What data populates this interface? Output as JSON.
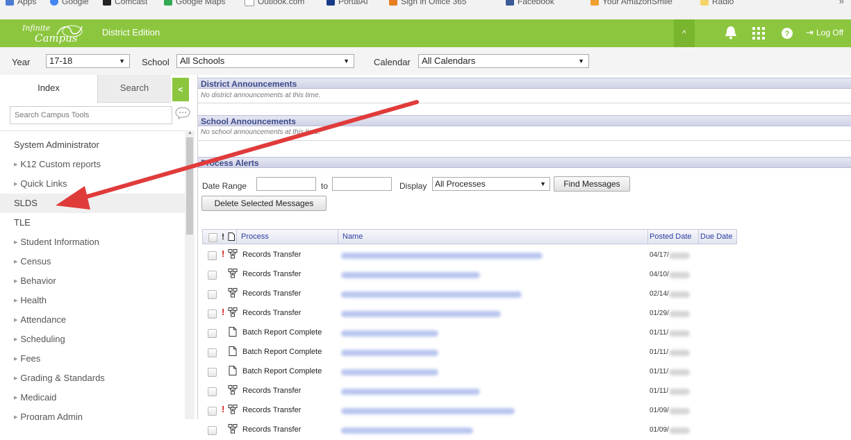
{
  "bookmarks": [
    {
      "label": "Apps",
      "color": "#4a7bd0"
    },
    {
      "label": "Google",
      "color": "#4285f4"
    },
    {
      "label": "Comcast",
      "color": "#222222"
    },
    {
      "label": "Google Maps",
      "color": "#34a853"
    },
    {
      "label": "Outlook.com",
      "color": "#cccccc"
    },
    {
      "label": "PortalAI",
      "color": "#1a3a8a"
    },
    {
      "label": "Sign in Office 365",
      "color": "#e67e22"
    },
    {
      "label": "Facebook",
      "color": "#3b5998"
    },
    {
      "label": "Your AmazonSmile",
      "color": "#f0a030"
    },
    {
      "label": "Radio",
      "color": "#f5d46a"
    }
  ],
  "header": {
    "logo_line1": "Infinite",
    "logo_line2": "Campus",
    "edition": "District Edition",
    "collapse_icon": "chevron-up-icon",
    "notification_icon": "bell-icon",
    "apps_icon": "grid-icon",
    "help_icon": "help-icon",
    "logoff_label": "Log Off",
    "accent_color": "#8cc63f"
  },
  "toolbar": {
    "year_label": "Year",
    "year_value": "17-18",
    "school_label": "School",
    "school_value": "All Schools",
    "calendar_label": "Calendar",
    "calendar_value": "All Calendars"
  },
  "sidebar": {
    "tab_index": "Index",
    "tab_search": "Search",
    "collapse_label": "<",
    "search_placeholder": "Search Campus Tools",
    "items": [
      {
        "label": "System Administrator",
        "type": "top"
      },
      {
        "label": "K12 Custom reports",
        "type": "sub"
      },
      {
        "label": "Quick Links",
        "type": "sub"
      },
      {
        "label": "SLDS",
        "type": "top",
        "highlight": true
      },
      {
        "label": "TLE",
        "type": "top"
      },
      {
        "label": "Student Information",
        "type": "sub"
      },
      {
        "label": "Census",
        "type": "sub"
      },
      {
        "label": "Behavior",
        "type": "sub"
      },
      {
        "label": "Health",
        "type": "sub"
      },
      {
        "label": "Attendance",
        "type": "sub"
      },
      {
        "label": "Scheduling",
        "type": "sub"
      },
      {
        "label": "Fees",
        "type": "sub"
      },
      {
        "label": "Grading & Standards",
        "type": "sub"
      },
      {
        "label": "Medicaid",
        "type": "sub"
      },
      {
        "label": "Program Admin",
        "type": "sub"
      }
    ]
  },
  "main": {
    "district_title": "District Announcements",
    "district_msg": "No district announcements at this time.",
    "school_title": "School Announcements",
    "school_msg": "No school announcements at this time.",
    "process_title": "Process Alerts",
    "date_range_label": "Date Range",
    "to_label": "to",
    "display_label": "Display",
    "display_value": "All Processes",
    "find_button": "Find Messages",
    "delete_button": "Delete Selected Messages",
    "table": {
      "headers": {
        "process": "Process",
        "name": "Name",
        "posted": "Posted Date",
        "due": "Due Date"
      },
      "rows": [
        {
          "alert": true,
          "icon": "process-flow-icon",
          "process": "Records Transfer",
          "posted": "04/17/"
        },
        {
          "alert": false,
          "icon": "process-flow-icon",
          "process": "Records Transfer",
          "posted": "04/10/"
        },
        {
          "alert": false,
          "icon": "process-flow-icon",
          "process": "Records Transfer",
          "posted": "02/14/"
        },
        {
          "alert": true,
          "icon": "process-flow-icon",
          "process": "Records Transfer",
          "posted": "01/29/"
        },
        {
          "alert": false,
          "icon": "document-icon",
          "process": "Batch Report Complete",
          "posted": "01/11/"
        },
        {
          "alert": false,
          "icon": "document-icon",
          "process": "Batch Report Complete",
          "posted": "01/11/"
        },
        {
          "alert": false,
          "icon": "document-icon",
          "process": "Batch Report Complete",
          "posted": "01/11/"
        },
        {
          "alert": false,
          "icon": "process-flow-icon",
          "process": "Records Transfer",
          "posted": "01/11/"
        },
        {
          "alert": true,
          "icon": "process-flow-icon",
          "process": "Records Transfer",
          "posted": "01/09/"
        },
        {
          "alert": false,
          "icon": "process-flow-icon",
          "process": "Records Transfer",
          "posted": "01/09/"
        }
      ]
    }
  },
  "annotation": {
    "color": "#e03b3b"
  }
}
